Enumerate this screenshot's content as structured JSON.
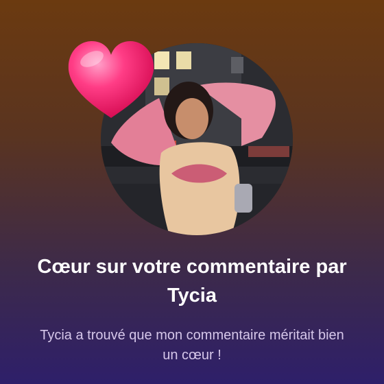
{
  "notification": {
    "title": "Cœur sur votre commentaire par Tycia",
    "body": "Tycia a trouvé que mon commentaire méritait bien un cœur !"
  },
  "icons": {
    "reaction": "heart-icon",
    "user": "avatar-photo"
  },
  "colors": {
    "background_top": "#6b3a10",
    "background_bottom": "#2e1f6a",
    "heart": "#ff2f79",
    "title_text": "#ffffff",
    "body_text": "#d6c7ea"
  }
}
